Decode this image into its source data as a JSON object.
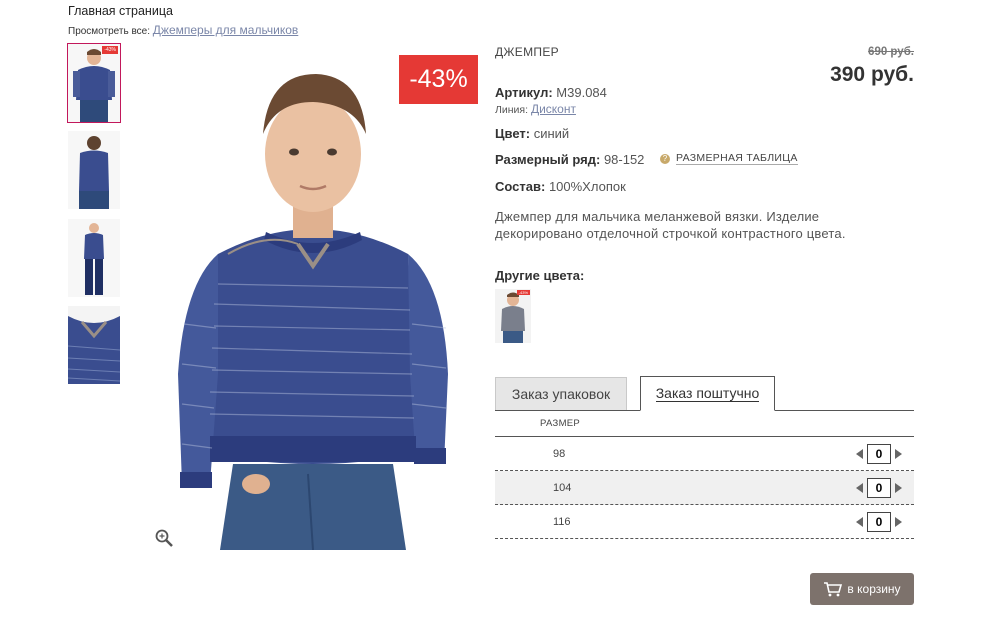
{
  "breadcrumb": {
    "home": "Главная страница"
  },
  "view_all": {
    "prefix": "Просмотреть все:",
    "link": "Джемперы для мальчиков"
  },
  "product": {
    "title": "ДЖЕМПЕР",
    "old_price": "690 руб.",
    "new_price": "390 руб.",
    "discount": "-43%",
    "thumb_badge": "-43%",
    "sku_label": "Артикул:",
    "sku_value": "M39.084",
    "line_label": "Линия:",
    "line_value": "Дисконт",
    "color_label": "Цвет:",
    "color_value": "синий",
    "size_range_label": "Размерный ряд:",
    "size_range_value": "98-152",
    "size_chart_link": "РАЗМЕРНАЯ ТАБЛИЦА",
    "composition_label": "Состав:",
    "composition_value": "100%Хлопок",
    "description": "Джемпер для мальчика меланжевой вязки. Изделие декорировано отделочной строчкой контрастного цвета.",
    "other_colors_label": "Другие цвета:"
  },
  "order_tabs": [
    {
      "label": "Заказ упаковок",
      "active": false
    },
    {
      "label": "Заказ поштучно",
      "active": true
    }
  ],
  "size_table": {
    "header": "РАЗМЕР",
    "rows": [
      {
        "size": "98",
        "qty": "0"
      },
      {
        "size": "104",
        "qty": "0"
      },
      {
        "size": "116",
        "qty": "0"
      }
    ]
  },
  "cart_button": "в корзину",
  "colors": {
    "discount_red": "#e53935",
    "sweater_blue": "#3a4d8f",
    "cart_bg": "#7d726c",
    "link": "#7a86a8"
  }
}
